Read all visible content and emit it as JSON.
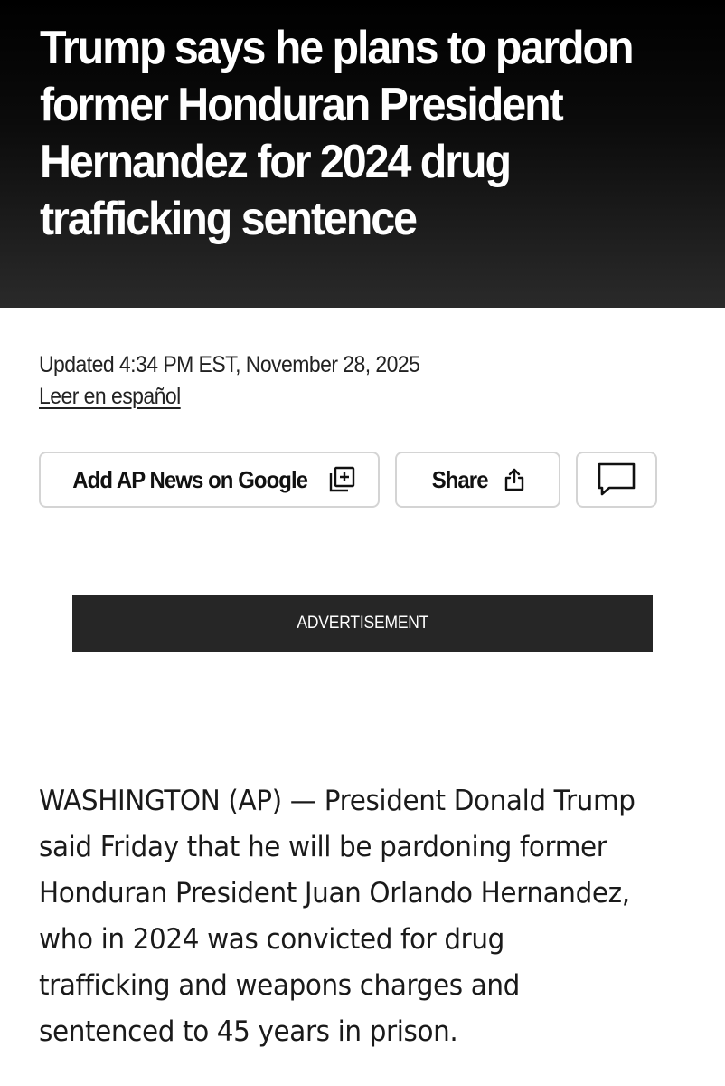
{
  "article": {
    "headline": "Trump says he plans to pardon former Honduran President Hernandez for 2024 drug trafficking sentence",
    "updated": "Updated 4:34 PM EST, November 28, 2025",
    "language_link": "Leer en español",
    "body": "WASHINGTON (AP) — President Donald Trump said Friday that he will be pardoning former Honduran President Juan Orlando Hernandez, who in 2024 was convicted for drug trafficking and weapons charges and sentenced to 45 years in prison."
  },
  "actions": {
    "google_label": "Add AP News on Google",
    "google_icon": "add-to-library-icon",
    "share_label": "Share",
    "share_icon": "share-upload-icon",
    "comment_icon": "comment-bubble-icon"
  },
  "advertisement": {
    "label": "ADVERTISEMENT"
  },
  "colors": {
    "hero_top": "#000000",
    "hero_bottom": "#2a2a2a",
    "ad_background": "#262626",
    "button_border": "#d4d4d4"
  }
}
